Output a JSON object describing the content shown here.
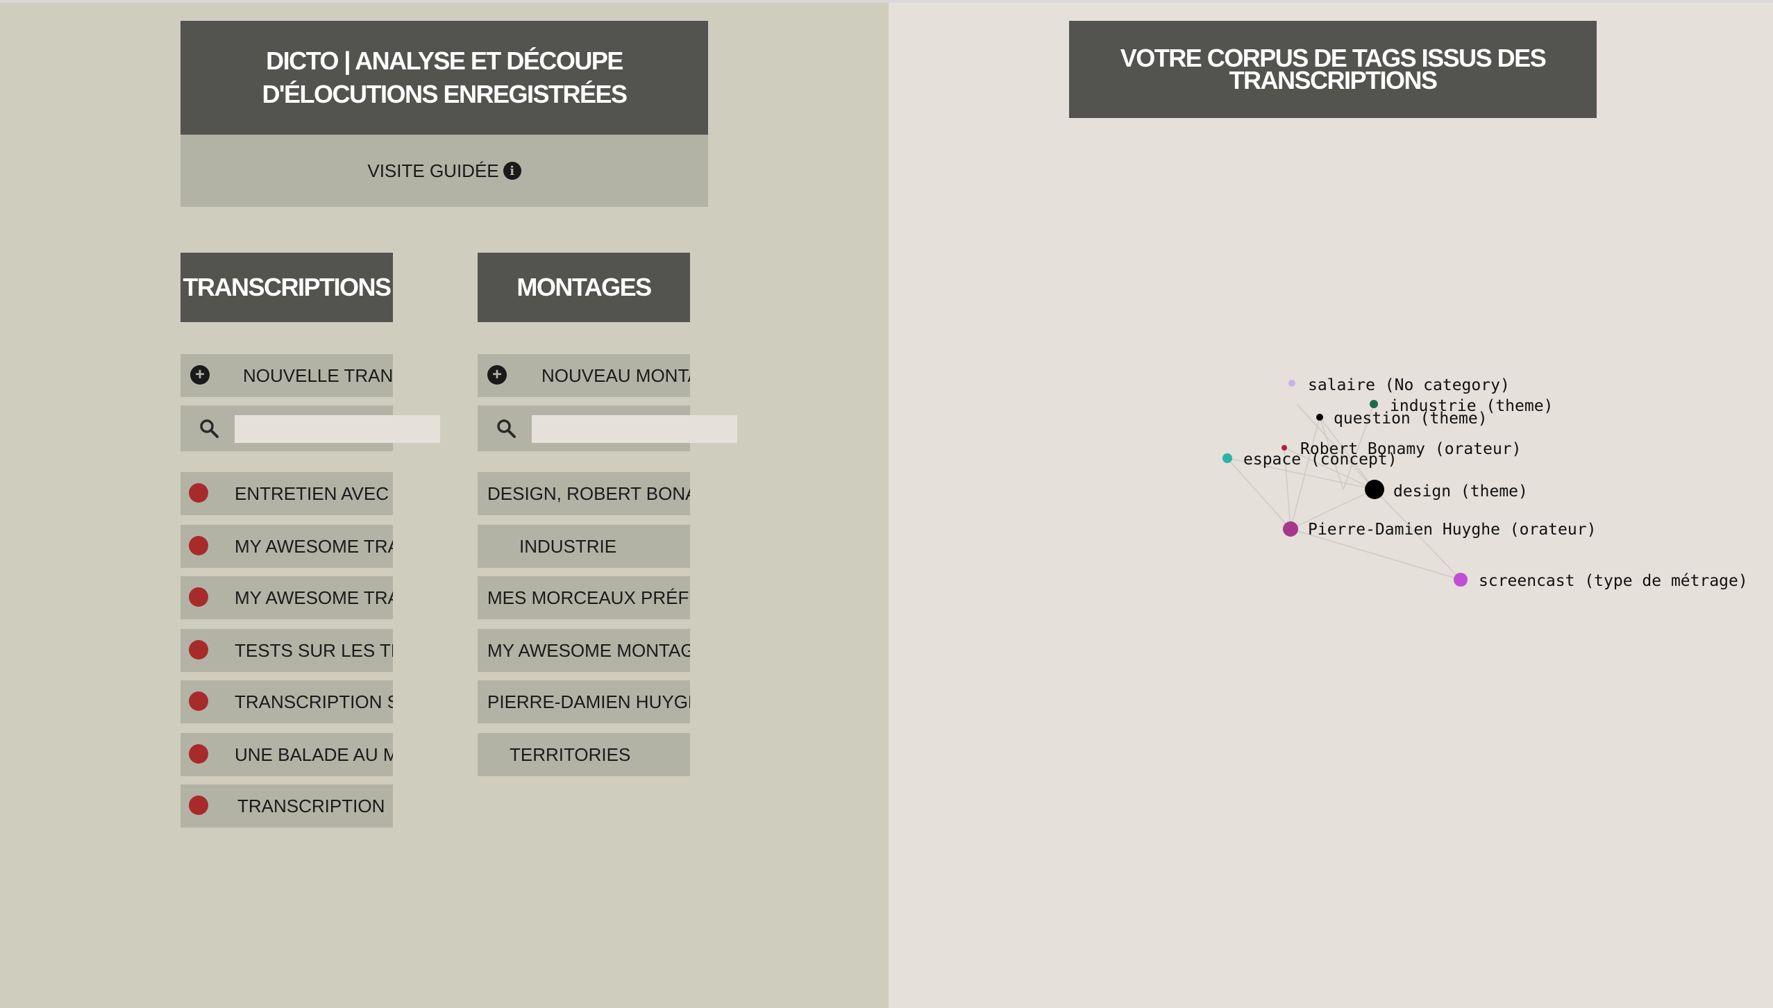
{
  "header": {
    "title": "DICTO | ANALYSE ET DÉCOUPE D'ÉLOCUTIONS ENREGISTRÉES",
    "guided_tour": "VISITE GUIDÉE"
  },
  "transcriptions": {
    "heading": "TRANSCRIPTIONS",
    "new_label": "NOUVELLE TRANSCRIPTION",
    "search_placeholder": "",
    "items": [
      "ENTRETIEN AVEC P",
      "MY AWESOME TRA",
      "MY AWESOME TRA",
      "TESTS SUR LES TRA",
      "TRANSCRIPTION SA",
      "UNE BALADE AU M",
      "TRANSCRIPTION"
    ]
  },
  "montages": {
    "heading": "MONTAGES",
    "new_label": "NOUVEAU MONTAGE",
    "search_placeholder": "",
    "items": [
      "DESIGN, ROBERT BONAM",
      "INDUSTRIE",
      "MES MORCEAUX PRÉFÉR",
      "MY AWESOME MONTAG",
      "PIERRE-DAMIEN HUYGH",
      "TERRITORIES"
    ]
  },
  "tags_panel": {
    "title": "VOTRE CORPUS DE TAGS ISSUS DES TRANSCRIPTIONS"
  },
  "graph": {
    "nodes": [
      {
        "label": "salaire (No category)",
        "color": "#c7b4e6"
      },
      {
        "label": "industrie (theme)",
        "color": "#1f6b4a"
      },
      {
        "label": "question (theme)",
        "color": "#000000"
      },
      {
        "label": "Robert Bonamy (orateur)",
        "color": "#b51c3c"
      },
      {
        "label": "espace (concept)",
        "color": "#2ab3a6"
      },
      {
        "label": "design (theme)",
        "color": "#000000"
      },
      {
        "label": "Pierre-Damien Huyghe (orateur)",
        "color": "#a8388a"
      },
      {
        "label": "screencast (type de métrage)",
        "color": "#c04fd1"
      }
    ]
  },
  "colors": {
    "left_bg": "#cfcdbd",
    "right_bg": "#e5e0d9",
    "dark_block": "#535450",
    "light_block": "#b3b3a5",
    "transcription_dot": "#a82b2b"
  }
}
